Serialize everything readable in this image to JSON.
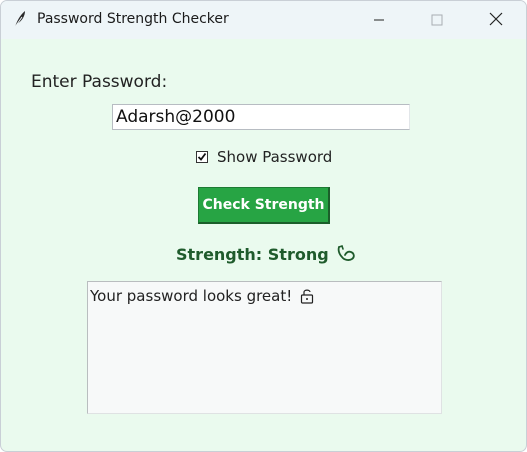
{
  "window": {
    "title": "Password Strength Checker",
    "icon": "feather-icon",
    "controls": [
      "minimize-icon",
      "maximize-icon",
      "close-icon"
    ]
  },
  "form": {
    "prompt_label": "Enter Password:",
    "password_value": "Adarsh@2000",
    "show_password_label": "Show Password",
    "show_password_checked": true,
    "check_button_label": "Check Strength"
  },
  "result": {
    "strength_text": "Strength: Strong",
    "strength_icon": "flexed-arm-icon",
    "strength_color": "#1f5b2c",
    "feedback_text": "Your password looks great!",
    "feedback_icon": "unlocked-padlock-icon"
  },
  "colors": {
    "window_background": "#eafaee",
    "button_background": "#27a444",
    "button_text": "#ffffff"
  }
}
